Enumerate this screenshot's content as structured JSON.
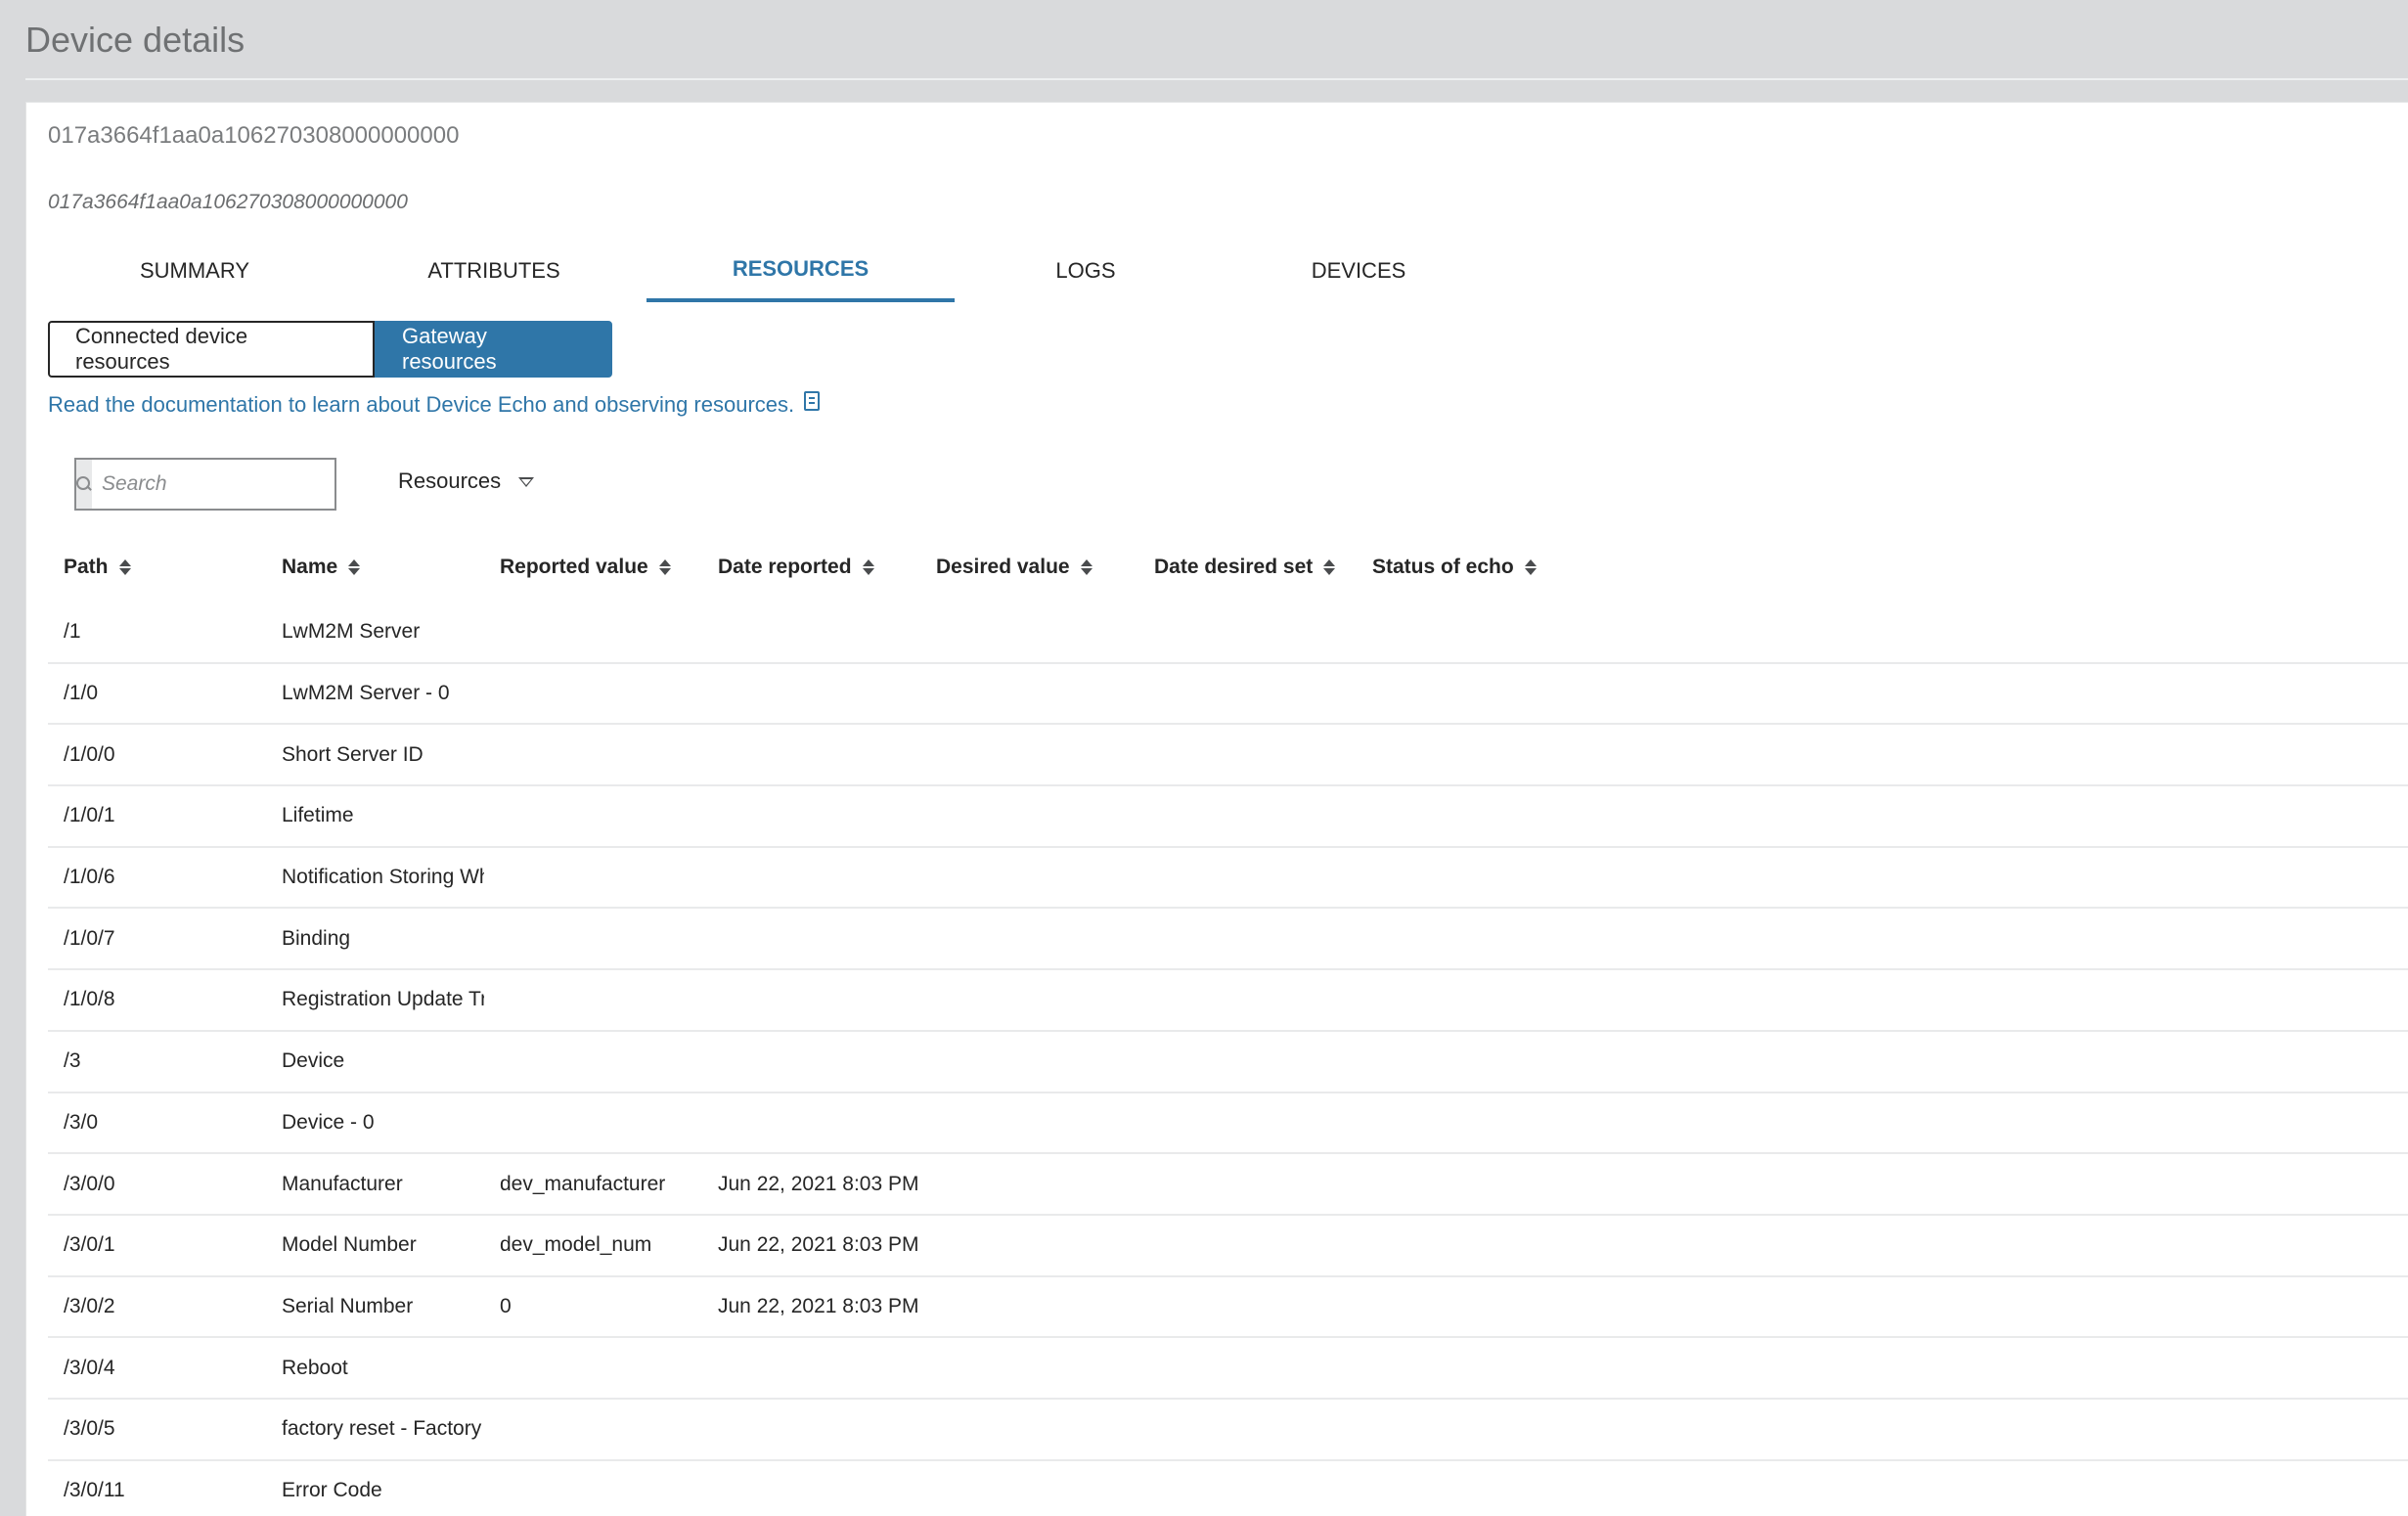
{
  "page": {
    "title": "Device details"
  },
  "device": {
    "id": "017a3664f1aa0a106270308000000000",
    "subtitle": "017a3664f1aa0a106270308000000000"
  },
  "tabs": [
    "SUMMARY",
    "ATTRIBUTES",
    "RESOURCES",
    "LOGS",
    "DEVICES"
  ],
  "active_tab": "RESOURCES",
  "segment": {
    "connected_label": "Connected device resources",
    "gateway_label": "Gateway resources",
    "selected": "Gateway resources"
  },
  "doc_link": {
    "text": "Read the documentation to learn about Device Echo and observing resources.",
    "icon": "document-icon"
  },
  "search": {
    "placeholder": "Search",
    "value": "",
    "icon": "search-icon"
  },
  "filter": {
    "label": "Resources",
    "icon": "chevron-down-icon"
  },
  "table": {
    "columns": [
      "Path",
      "Name",
      "Reported value",
      "Date reported",
      "Desired value",
      "Date desired set",
      "Status of echo"
    ],
    "rows": [
      {
        "path": "/1",
        "name": "LwM2M Server",
        "reported": "",
        "date_reported": "",
        "desired": "",
        "date_desired": "",
        "status": ""
      },
      {
        "path": "/1/0",
        "name": "LwM2M Server - 0",
        "reported": "",
        "date_reported": "",
        "desired": "",
        "date_desired": "",
        "status": ""
      },
      {
        "path": "/1/0/0",
        "name": "Short Server ID",
        "reported": "",
        "date_reported": "",
        "desired": "",
        "date_desired": "",
        "status": ""
      },
      {
        "path": "/1/0/1",
        "name": "Lifetime",
        "reported": "",
        "date_reported": "",
        "desired": "",
        "date_desired": "",
        "status": ""
      },
      {
        "path": "/1/0/6",
        "name": "Notification Storing When Disa...",
        "reported": "",
        "date_reported": "",
        "desired": "",
        "date_desired": "",
        "status": ""
      },
      {
        "path": "/1/0/7",
        "name": "Binding",
        "reported": "",
        "date_reported": "",
        "desired": "",
        "date_desired": "",
        "status": ""
      },
      {
        "path": "/1/0/8",
        "name": "Registration Update Trigger",
        "reported": "",
        "date_reported": "",
        "desired": "",
        "date_desired": "",
        "status": ""
      },
      {
        "path": "/3",
        "name": "Device",
        "reported": "",
        "date_reported": "",
        "desired": "",
        "date_desired": "",
        "status": ""
      },
      {
        "path": "/3/0",
        "name": "Device - 0",
        "reported": "",
        "date_reported": "",
        "desired": "",
        "date_desired": "",
        "status": ""
      },
      {
        "path": "/3/0/0",
        "name": "Manufacturer",
        "reported": "dev_manufacturer",
        "date_reported": "Jun 22, 2021 8:03 PM",
        "desired": "",
        "date_desired": "",
        "status": ""
      },
      {
        "path": "/3/0/1",
        "name": "Model Number",
        "reported": "dev_model_num",
        "date_reported": "Jun 22, 2021 8:03 PM",
        "desired": "",
        "date_desired": "",
        "status": ""
      },
      {
        "path": "/3/0/2",
        "name": "Serial Number",
        "reported": "0",
        "date_reported": "Jun 22, 2021 8:03 PM",
        "desired": "",
        "date_desired": "",
        "status": ""
      },
      {
        "path": "/3/0/4",
        "name": "Reboot",
        "reported": "",
        "date_reported": "",
        "desired": "",
        "date_desired": "",
        "status": ""
      },
      {
        "path": "/3/0/5",
        "name": "factory reset - Factory Reset",
        "reported": "",
        "date_reported": "",
        "desired": "",
        "date_desired": "",
        "status": ""
      },
      {
        "path": "/3/0/11",
        "name": "Error Code",
        "reported": "",
        "date_reported": "",
        "desired": "",
        "date_desired": "",
        "status": ""
      }
    ]
  },
  "colors": {
    "accent": "#2f76a8",
    "background": "#d9dadc",
    "panel": "#ffffff"
  }
}
